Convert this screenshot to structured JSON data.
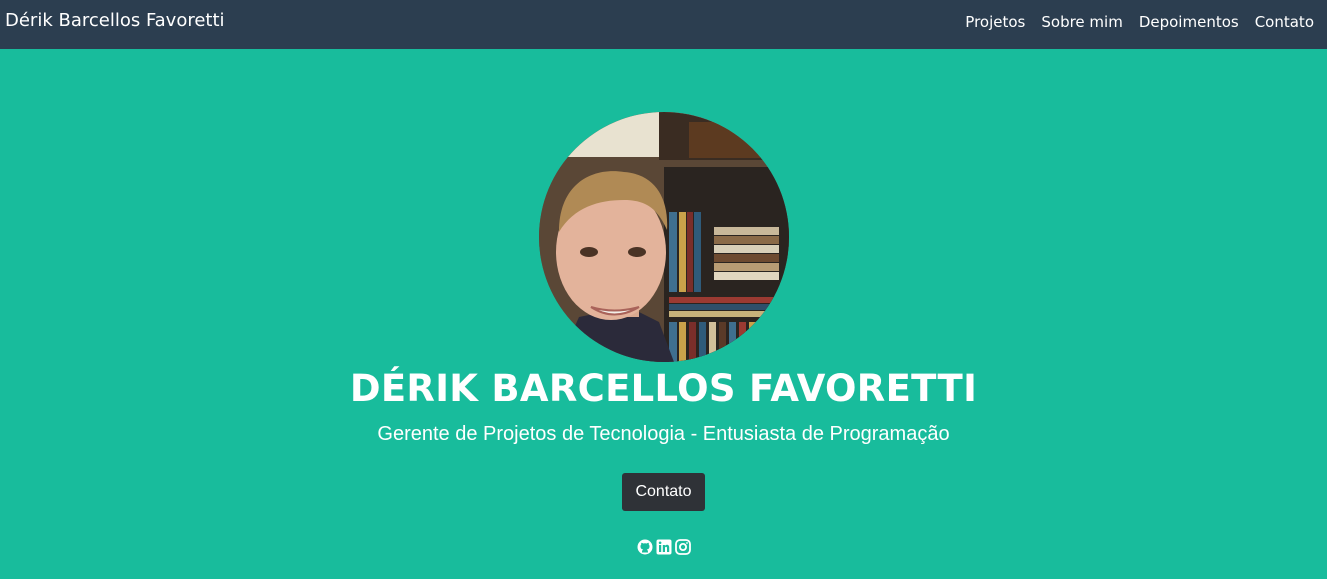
{
  "brand": "Dérik Barcellos Favoretti",
  "nav": [
    {
      "label": "Projetos"
    },
    {
      "label": "Sobre mim"
    },
    {
      "label": "Depoimentos"
    },
    {
      "label": "Contato"
    }
  ],
  "hero": {
    "name": "DÉRIK BARCELLOS FAVORETTI",
    "subtitle": "Gerente de Projetos de Tecnologia - Entusiasta de Programação",
    "button_label": "Contato"
  },
  "socials": [
    {
      "icon": "github-icon"
    },
    {
      "icon": "linkedin-icon"
    },
    {
      "icon": "instagram-icon"
    }
  ],
  "colors": {
    "navbar": "#2c3e50",
    "hero_background": "#18bc9c",
    "button": "#2f3237",
    "text": "#ffffff"
  }
}
